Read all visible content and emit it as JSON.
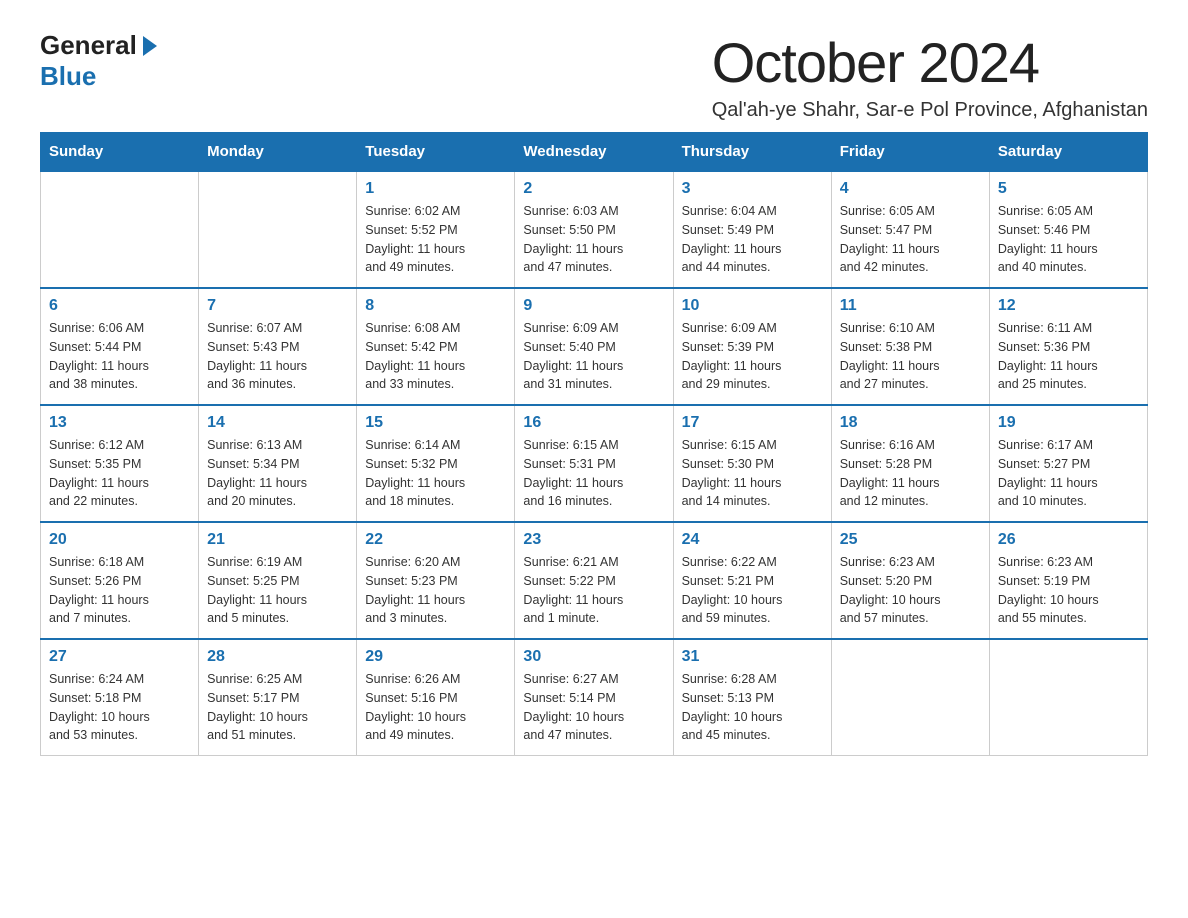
{
  "logo": {
    "general": "General",
    "triangle": "",
    "blue": "Blue"
  },
  "title": "October 2024",
  "subtitle": "Qal'ah-ye Shahr, Sar-e Pol Province, Afghanistan",
  "days_of_week": [
    "Sunday",
    "Monday",
    "Tuesday",
    "Wednesday",
    "Thursday",
    "Friday",
    "Saturday"
  ],
  "weeks": [
    [
      {
        "day": "",
        "info": ""
      },
      {
        "day": "",
        "info": ""
      },
      {
        "day": "1",
        "info": "Sunrise: 6:02 AM\nSunset: 5:52 PM\nDaylight: 11 hours\nand 49 minutes."
      },
      {
        "day": "2",
        "info": "Sunrise: 6:03 AM\nSunset: 5:50 PM\nDaylight: 11 hours\nand 47 minutes."
      },
      {
        "day": "3",
        "info": "Sunrise: 6:04 AM\nSunset: 5:49 PM\nDaylight: 11 hours\nand 44 minutes."
      },
      {
        "day": "4",
        "info": "Sunrise: 6:05 AM\nSunset: 5:47 PM\nDaylight: 11 hours\nand 42 minutes."
      },
      {
        "day": "5",
        "info": "Sunrise: 6:05 AM\nSunset: 5:46 PM\nDaylight: 11 hours\nand 40 minutes."
      }
    ],
    [
      {
        "day": "6",
        "info": "Sunrise: 6:06 AM\nSunset: 5:44 PM\nDaylight: 11 hours\nand 38 minutes."
      },
      {
        "day": "7",
        "info": "Sunrise: 6:07 AM\nSunset: 5:43 PM\nDaylight: 11 hours\nand 36 minutes."
      },
      {
        "day": "8",
        "info": "Sunrise: 6:08 AM\nSunset: 5:42 PM\nDaylight: 11 hours\nand 33 minutes."
      },
      {
        "day": "9",
        "info": "Sunrise: 6:09 AM\nSunset: 5:40 PM\nDaylight: 11 hours\nand 31 minutes."
      },
      {
        "day": "10",
        "info": "Sunrise: 6:09 AM\nSunset: 5:39 PM\nDaylight: 11 hours\nand 29 minutes."
      },
      {
        "day": "11",
        "info": "Sunrise: 6:10 AM\nSunset: 5:38 PM\nDaylight: 11 hours\nand 27 minutes."
      },
      {
        "day": "12",
        "info": "Sunrise: 6:11 AM\nSunset: 5:36 PM\nDaylight: 11 hours\nand 25 minutes."
      }
    ],
    [
      {
        "day": "13",
        "info": "Sunrise: 6:12 AM\nSunset: 5:35 PM\nDaylight: 11 hours\nand 22 minutes."
      },
      {
        "day": "14",
        "info": "Sunrise: 6:13 AM\nSunset: 5:34 PM\nDaylight: 11 hours\nand 20 minutes."
      },
      {
        "day": "15",
        "info": "Sunrise: 6:14 AM\nSunset: 5:32 PM\nDaylight: 11 hours\nand 18 minutes."
      },
      {
        "day": "16",
        "info": "Sunrise: 6:15 AM\nSunset: 5:31 PM\nDaylight: 11 hours\nand 16 minutes."
      },
      {
        "day": "17",
        "info": "Sunrise: 6:15 AM\nSunset: 5:30 PM\nDaylight: 11 hours\nand 14 minutes."
      },
      {
        "day": "18",
        "info": "Sunrise: 6:16 AM\nSunset: 5:28 PM\nDaylight: 11 hours\nand 12 minutes."
      },
      {
        "day": "19",
        "info": "Sunrise: 6:17 AM\nSunset: 5:27 PM\nDaylight: 11 hours\nand 10 minutes."
      }
    ],
    [
      {
        "day": "20",
        "info": "Sunrise: 6:18 AM\nSunset: 5:26 PM\nDaylight: 11 hours\nand 7 minutes."
      },
      {
        "day": "21",
        "info": "Sunrise: 6:19 AM\nSunset: 5:25 PM\nDaylight: 11 hours\nand 5 minutes."
      },
      {
        "day": "22",
        "info": "Sunrise: 6:20 AM\nSunset: 5:23 PM\nDaylight: 11 hours\nand 3 minutes."
      },
      {
        "day": "23",
        "info": "Sunrise: 6:21 AM\nSunset: 5:22 PM\nDaylight: 11 hours\nand 1 minute."
      },
      {
        "day": "24",
        "info": "Sunrise: 6:22 AM\nSunset: 5:21 PM\nDaylight: 10 hours\nand 59 minutes."
      },
      {
        "day": "25",
        "info": "Sunrise: 6:23 AM\nSunset: 5:20 PM\nDaylight: 10 hours\nand 57 minutes."
      },
      {
        "day": "26",
        "info": "Sunrise: 6:23 AM\nSunset: 5:19 PM\nDaylight: 10 hours\nand 55 minutes."
      }
    ],
    [
      {
        "day": "27",
        "info": "Sunrise: 6:24 AM\nSunset: 5:18 PM\nDaylight: 10 hours\nand 53 minutes."
      },
      {
        "day": "28",
        "info": "Sunrise: 6:25 AM\nSunset: 5:17 PM\nDaylight: 10 hours\nand 51 minutes."
      },
      {
        "day": "29",
        "info": "Sunrise: 6:26 AM\nSunset: 5:16 PM\nDaylight: 10 hours\nand 49 minutes."
      },
      {
        "day": "30",
        "info": "Sunrise: 6:27 AM\nSunset: 5:14 PM\nDaylight: 10 hours\nand 47 minutes."
      },
      {
        "day": "31",
        "info": "Sunrise: 6:28 AM\nSunset: 5:13 PM\nDaylight: 10 hours\nand 45 minutes."
      },
      {
        "day": "",
        "info": ""
      },
      {
        "day": "",
        "info": ""
      }
    ]
  ]
}
